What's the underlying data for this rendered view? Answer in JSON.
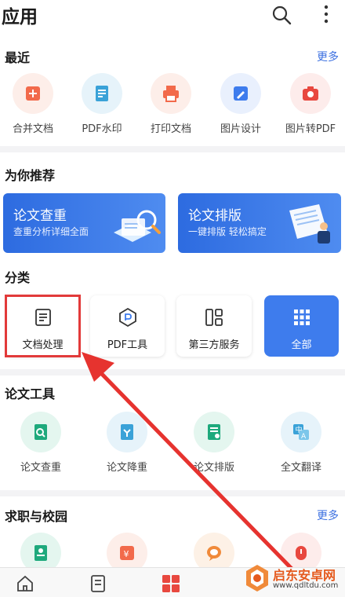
{
  "header": {
    "title": "应用"
  },
  "recent": {
    "title": "最近",
    "more": "更多",
    "items": [
      {
        "label": "合并文档",
        "icon": "merge-doc-icon",
        "color": "#f26a4b",
        "bg": "#fdeee9"
      },
      {
        "label": "PDF水印",
        "icon": "pdf-watermark-icon",
        "color": "#3aa2d8",
        "bg": "#e6f3fa"
      },
      {
        "label": "打印文档",
        "icon": "printer-icon",
        "color": "#f26a4b",
        "bg": "#fdeee9"
      },
      {
        "label": "图片设计",
        "icon": "image-design-icon",
        "color": "#3e7ced",
        "bg": "#e9f0fd"
      },
      {
        "label": "图片转PDF",
        "icon": "image-to-pdf-icon",
        "color": "#e8483f",
        "bg": "#fdeceb"
      }
    ]
  },
  "recommend": {
    "title": "为你推荐",
    "banners": [
      {
        "title": "论文查重",
        "subtitle": "查重分析详细全面"
      },
      {
        "title": "论文排版",
        "subtitle": "一键排版 轻松搞定"
      }
    ]
  },
  "category": {
    "title": "分类",
    "items": [
      {
        "label": "文档处理",
        "icon": "document-icon"
      },
      {
        "label": "PDF工具",
        "icon": "pdf-tool-icon"
      },
      {
        "label": "第三方服务",
        "icon": "third-party-icon"
      },
      {
        "label": "全部",
        "icon": "grid-icon"
      }
    ]
  },
  "thesis_tools": {
    "title": "论文工具",
    "items": [
      {
        "label": "论文查重",
        "icon": "thesis-check-icon",
        "color": "#1ea97c",
        "bg": "#e4f6ef"
      },
      {
        "label": "论文降重",
        "icon": "thesis-reduce-icon",
        "color": "#3aa2d8",
        "bg": "#e6f3fa"
      },
      {
        "label": "论文排版",
        "icon": "thesis-layout-icon",
        "color": "#1ea97c",
        "bg": "#e4f6ef"
      },
      {
        "label": "全文翻译",
        "icon": "translate-icon",
        "color": "#3aa2d8",
        "bg": "#e6f3fa"
      }
    ]
  },
  "jobs": {
    "title": "求职与校园",
    "more": "更多"
  },
  "tabbar": {
    "active_color": "#e8483f"
  },
  "watermark": {
    "title": "启东安卓网",
    "url": "www.qdltdu.com"
  },
  "colors": {
    "accent": "#3e7ced",
    "highlight": "#e23a3a"
  }
}
